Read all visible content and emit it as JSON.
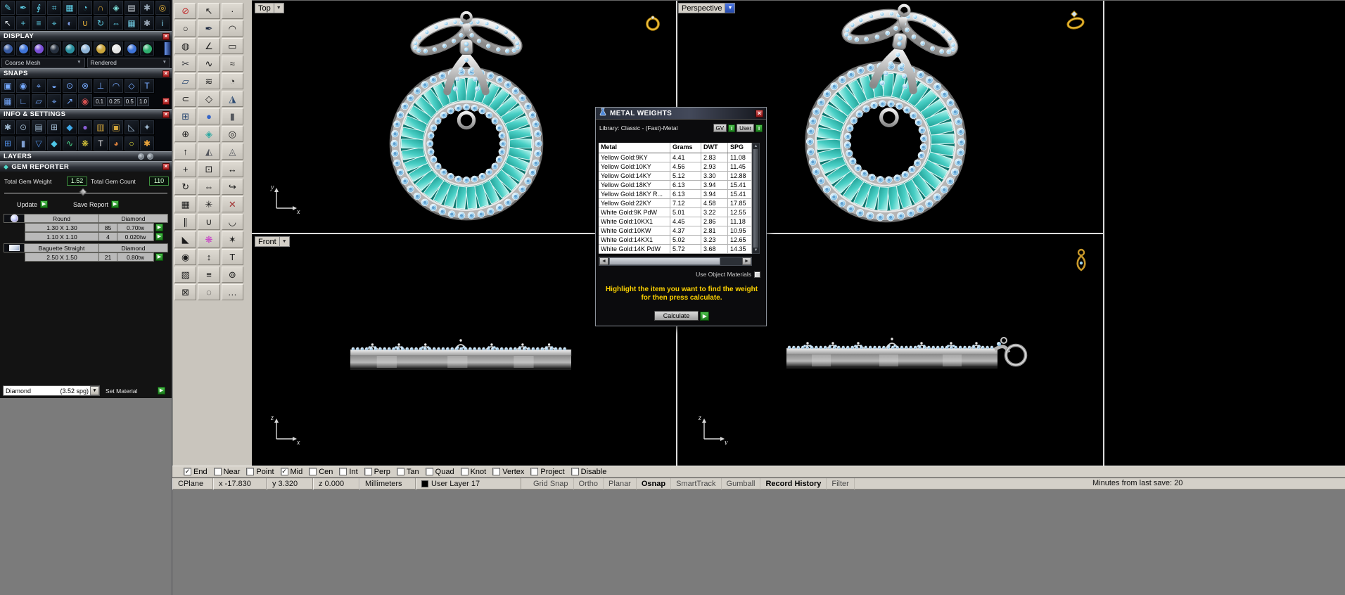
{
  "colors": {
    "accent_green": "#2f9e2f",
    "highlight_yellow": "#ffd400",
    "gem_round": "#a9d9f2",
    "gem_round_dark": "#4f93c9",
    "gem_baguette": "#49cfc5",
    "metal_light": "#f0f0f0",
    "metal_dark": "#8a8a8a",
    "viewport_bg": "#000000"
  },
  "left_panel": {
    "top_icons_row1": [
      "pencil",
      "pen-nib",
      "spiral",
      "control-points",
      "mesh-grid",
      "compass-tool",
      "magnet-tool",
      "gem-tool",
      "data-sheet",
      "gear-pair",
      "target-tool"
    ],
    "top_icons_row2": [
      "arrow-cursor",
      "pan-tool",
      "layer-stack",
      "crosshair-tool",
      "shaded-ball",
      "snap-magnet",
      "orbit-tool",
      "mirror-lr",
      "array-grid",
      "gear-single",
      "info-badge"
    ],
    "display": {
      "title": "DISPLAY",
      "modes": [
        "wireframe-mode",
        "shaded-mode",
        "rendered-mode",
        "ghosted-mode",
        "xray-mode",
        "technical-mode",
        "artistic-mode",
        "pen-mode",
        "raytraced-mode",
        "neon-mode"
      ],
      "mesh_dropdown": "Coarse Mesh",
      "render_dropdown": "Rendered"
    },
    "snaps": {
      "title": "SNAPS",
      "row1_icons": [
        "snap-end",
        "snap-near",
        "snap-point",
        "snap-mid",
        "snap-cen",
        "snap-int",
        "snap-perp",
        "snap-tan",
        "snap-quad",
        "snap-knot"
      ],
      "row2_icons": [
        "grid-snap-icon",
        "ortho-icon",
        "planar-icon",
        "osnap-icon",
        "smarttrack-icon",
        "history-icon"
      ],
      "values": [
        "0.1",
        "0.25",
        "0.5",
        "1.0"
      ]
    },
    "info_settings": {
      "title": "INFO & SETTINGS",
      "row1_icons": [
        "gears-analyze",
        "search-report",
        "print-tool",
        "calc-tool",
        "paint-drop",
        "purple-ball",
        "gold-chart",
        "frame-tool",
        "ruler-tool",
        "bolt-tool"
      ],
      "row2_icons": [
        "cube-blue",
        "cylinder-icon",
        "funnel-tool",
        "droplet-tool",
        "curve-graph",
        "palette-tool",
        "text-T",
        "material-sphere",
        "bulb-tool",
        "render-gear"
      ]
    },
    "layers": {
      "title": "LAYERS"
    },
    "gem_reporter": {
      "title": "GEM REPORTER",
      "total_weight_label": "Total Gem Weight",
      "total_weight": "1.52",
      "total_count_label": "Total Gem Count",
      "total_count": "110",
      "update_label": "Update",
      "save_report_label": "Save Report",
      "rows": [
        {
          "kind": "group",
          "icon": "round-gem",
          "shape": "Round",
          "material": "Diamond"
        },
        {
          "kind": "item",
          "size": "1.30 X 1.30",
          "count": "85",
          "weight": "0.70tw"
        },
        {
          "kind": "item",
          "size": "1.10 X 1.10",
          "count": "4",
          "weight": "0.020tw"
        },
        {
          "kind": "group",
          "icon": "baguette-gem",
          "shape": "Baguette Straight",
          "material": "Diamond"
        },
        {
          "kind": "item",
          "size": "2.50 X 1.50",
          "count": "21",
          "weight": "0.80tw"
        }
      ],
      "material_name": "Diamond",
      "material_spg": "(3.52 spg)",
      "set_material_label": "Set Material"
    }
  },
  "main_toolbar": {
    "icons": [
      "cancel",
      "select-arrow",
      "single-point",
      "circle-tool",
      "curve-pen",
      "arc-tool",
      "ellipse-tool",
      "polyline-tool",
      "rectangle-tool",
      "scissors",
      "freeform-curve",
      "blend-curve",
      "surface-tool",
      "interp-curve",
      "conic-tool",
      "offset-tool",
      "hexagon-tool",
      "sweep-tool",
      "box-tool",
      "sphere-tool",
      "cylinder-tool",
      "boolean-union",
      "gem-cut",
      "torus-tool",
      "extrude-tool",
      "cone-tool",
      "pyramid-tool",
      "move-tool",
      "copy-tool",
      "scale-tool",
      "rotate-tool",
      "mirror-tool",
      "orient-tool",
      "array-rect",
      "array-polar",
      "trim-tool",
      "split-tool",
      "join-tool",
      "fillet-tool",
      "chamfer-tool",
      "magenta-render",
      "explode-tool",
      "analyze-tool",
      "dimension-tool",
      "text-tool",
      "hatch-tool",
      "layer-tool",
      "group-tool",
      "lock-tool",
      "hide-tool",
      "properties-tool"
    ]
  },
  "viewports": {
    "top": {
      "label": "Top",
      "axis_v": "y",
      "axis_h": "x"
    },
    "perspective": {
      "label": "Perspective"
    },
    "front": {
      "label": "Front",
      "axis_v": "z",
      "axis_h": "x"
    },
    "right": {
      "axis_v": "z",
      "axis_h": "y"
    }
  },
  "dialog": {
    "title": "METAL WEIGHTS",
    "library": "Library: Classic - (Fast)-Metal",
    "gv_label": "GV",
    "user_label": "User",
    "indicator": "I",
    "columns": [
      "Metal",
      "Grams",
      "DWT",
      "SPG"
    ],
    "rows": [
      [
        "Yellow Gold:9KY",
        "4.41",
        "2.83",
        "11.08"
      ],
      [
        "Yellow Gold:10KY",
        "4.56",
        "2.93",
        "11.45"
      ],
      [
        "Yellow Gold:14KY",
        "5.12",
        "3.30",
        "12.88"
      ],
      [
        "Yellow Gold:18KY",
        "6.13",
        "3.94",
        "15.41"
      ],
      [
        "Yellow Gold:18KY R...",
        "6.13",
        "3.94",
        "15.41"
      ],
      [
        "Yellow Gold:22KY",
        "7.12",
        "4.58",
        "17.85"
      ],
      [
        "White Gold:9K PdW",
        "5.01",
        "3.22",
        "12.55"
      ],
      [
        "White Gold:10KX1",
        "4.45",
        "2.86",
        "11.18"
      ],
      [
        "White Gold:10KW",
        "4.37",
        "2.81",
        "10.95"
      ],
      [
        "White Gold:14KX1",
        "5.02",
        "3.23",
        "12.65"
      ],
      [
        "White Gold:14K PdW",
        "5.72",
        "3.68",
        "14.35"
      ]
    ],
    "use_object_materials": "Use Object Materials",
    "instruction": "Highlight the item you want to find the weight for then press calculate.",
    "calculate_label": "Calculate"
  },
  "osnap_bar": {
    "items": [
      {
        "label": "End",
        "checked": true
      },
      {
        "label": "Near",
        "checked": false
      },
      {
        "label": "Point",
        "checked": false
      },
      {
        "label": "Mid",
        "checked": true
      },
      {
        "label": "Cen",
        "checked": false
      },
      {
        "label": "Int",
        "checked": false
      },
      {
        "label": "Perp",
        "checked": false
      },
      {
        "label": "Tan",
        "checked": false
      },
      {
        "label": "Quad",
        "checked": false
      },
      {
        "label": "Knot",
        "checked": false
      },
      {
        "label": "Vertex",
        "checked": false
      },
      {
        "label": "Project",
        "checked": false
      },
      {
        "label": "Disable",
        "checked": false
      }
    ]
  },
  "status_bar": {
    "panes": [
      "CPlane",
      "x -17.830",
      "y 3.320",
      "z 0.000",
      "Millimeters"
    ],
    "layer_label": "User Layer 17",
    "toggles": [
      {
        "label": "Grid Snap",
        "active": false
      },
      {
        "label": "Ortho",
        "active": false
      },
      {
        "label": "Planar",
        "active": false
      },
      {
        "label": "Osnap",
        "active": true
      },
      {
        "label": "SmartTrack",
        "active": false
      },
      {
        "label": "Gumball",
        "active": false
      },
      {
        "label": "Record History",
        "active": true
      },
      {
        "label": "Filter",
        "active": false
      }
    ],
    "save_info": "Minutes from last save: 20"
  }
}
